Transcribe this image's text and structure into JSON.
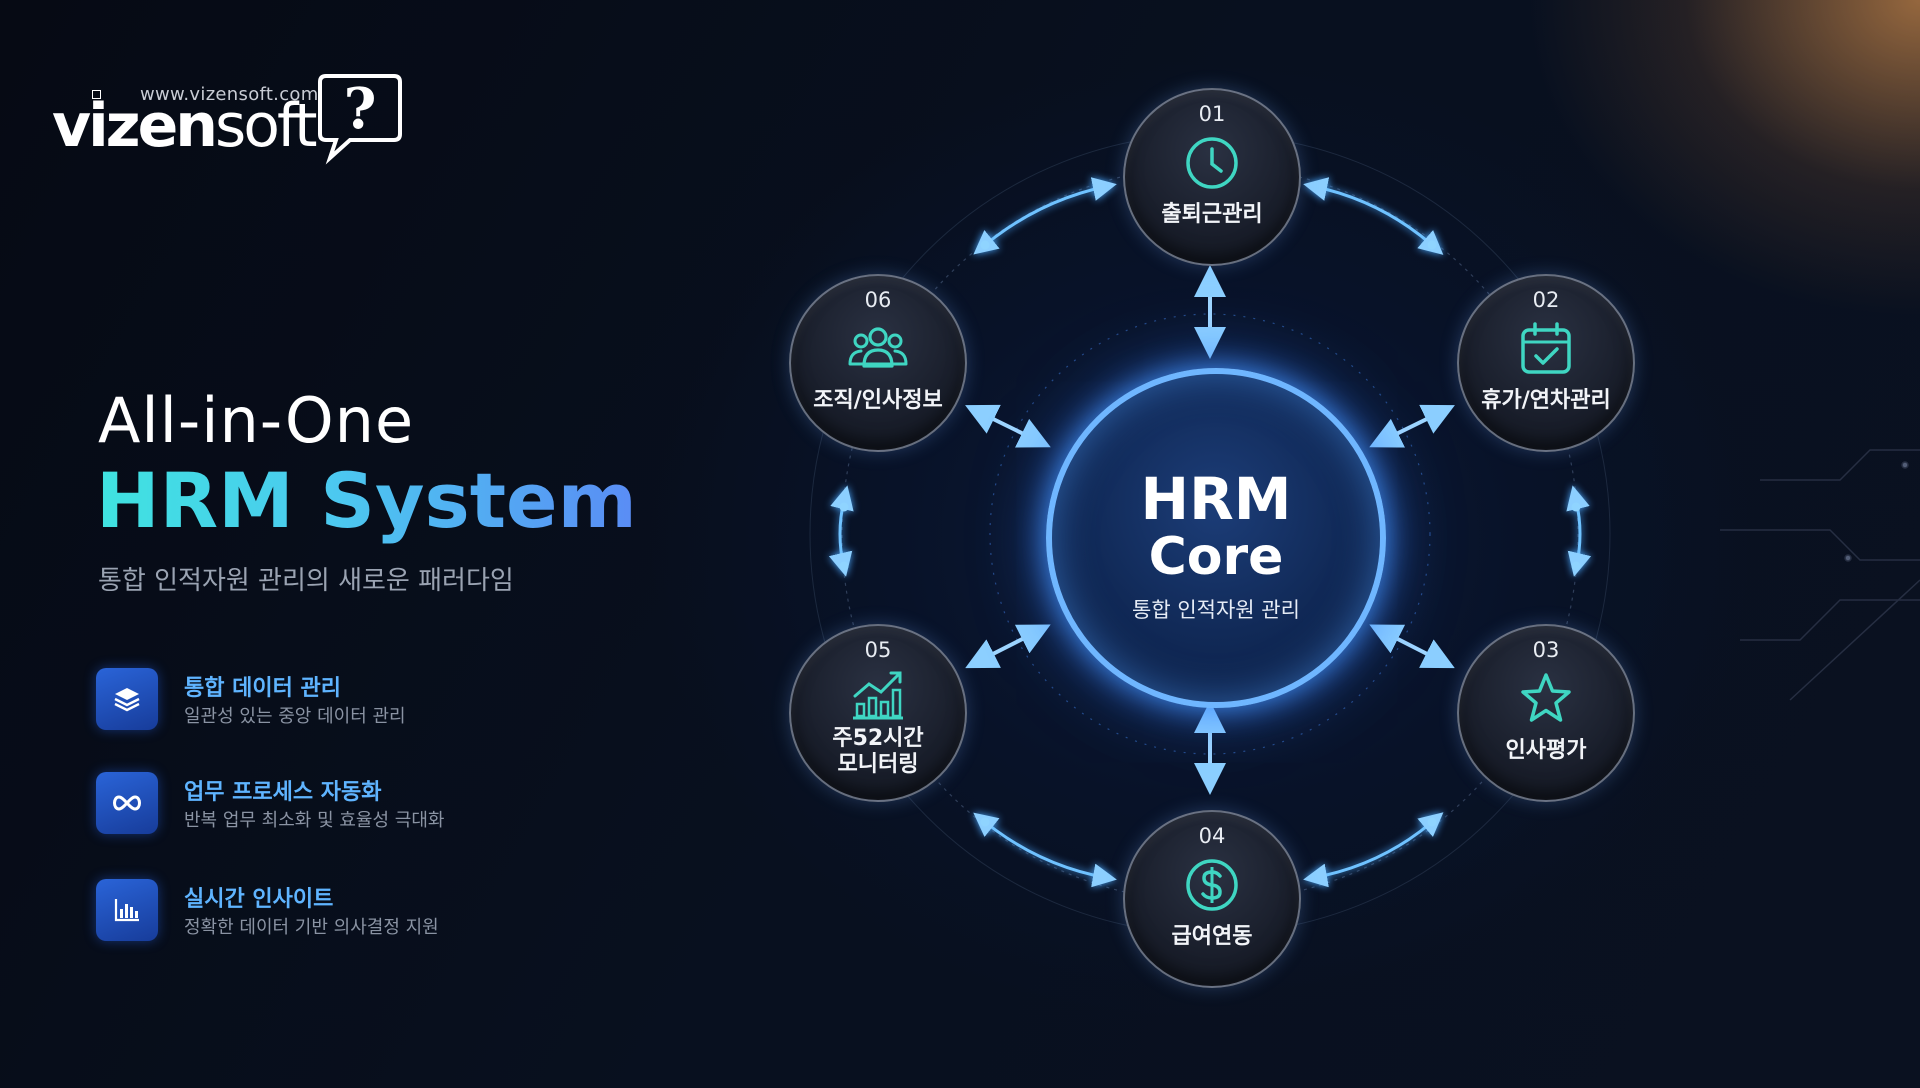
{
  "brand": {
    "url": "www.vizensoft.com",
    "name_bold": "vizen",
    "name_light": "soft",
    "bubble_glyph": "?"
  },
  "hero": {
    "line1": "All-in-One",
    "line2": "HRM System",
    "subtitle": "통합 인적자원 관리의 새로운 패러다임"
  },
  "features": [
    {
      "icon": "layers-icon",
      "title": "통합 데이터 관리",
      "desc": "일관성 있는 중앙 데이터 관리"
    },
    {
      "icon": "infinity-icon",
      "title": "업무 프로세스 자동화",
      "desc": "반복 업무 최소화 및 효율성 극대화"
    },
    {
      "icon": "bar-chart-icon",
      "title": "실시간 인사이트",
      "desc": "정확한 데이터 기반 의사결정 지원"
    }
  ],
  "core": {
    "line1": "HRM",
    "line2": "Core",
    "subtitle": "통합 인적자원 관리"
  },
  "modules": [
    {
      "num": "01",
      "label": "출퇴근관리",
      "icon": "clock-icon"
    },
    {
      "num": "02",
      "label": "휴가/연차관리",
      "icon": "calendar-check-icon"
    },
    {
      "num": "03",
      "label": "인사평가",
      "icon": "star-icon"
    },
    {
      "num": "04",
      "label": "급여연동",
      "icon": "dollar-icon"
    },
    {
      "num": "05",
      "label": "주52시간\n모니터링",
      "icon": "trend-chart-icon"
    },
    {
      "num": "06",
      "label": "조직/인사정보",
      "icon": "people-icon"
    }
  ],
  "colors": {
    "accent_cyan": "#3fe3e0",
    "accent_blue": "#5fb4ff",
    "core_ring": "#6fb6ff",
    "icon_teal": "#3fd6c2",
    "glow_orange": "#c48448"
  }
}
